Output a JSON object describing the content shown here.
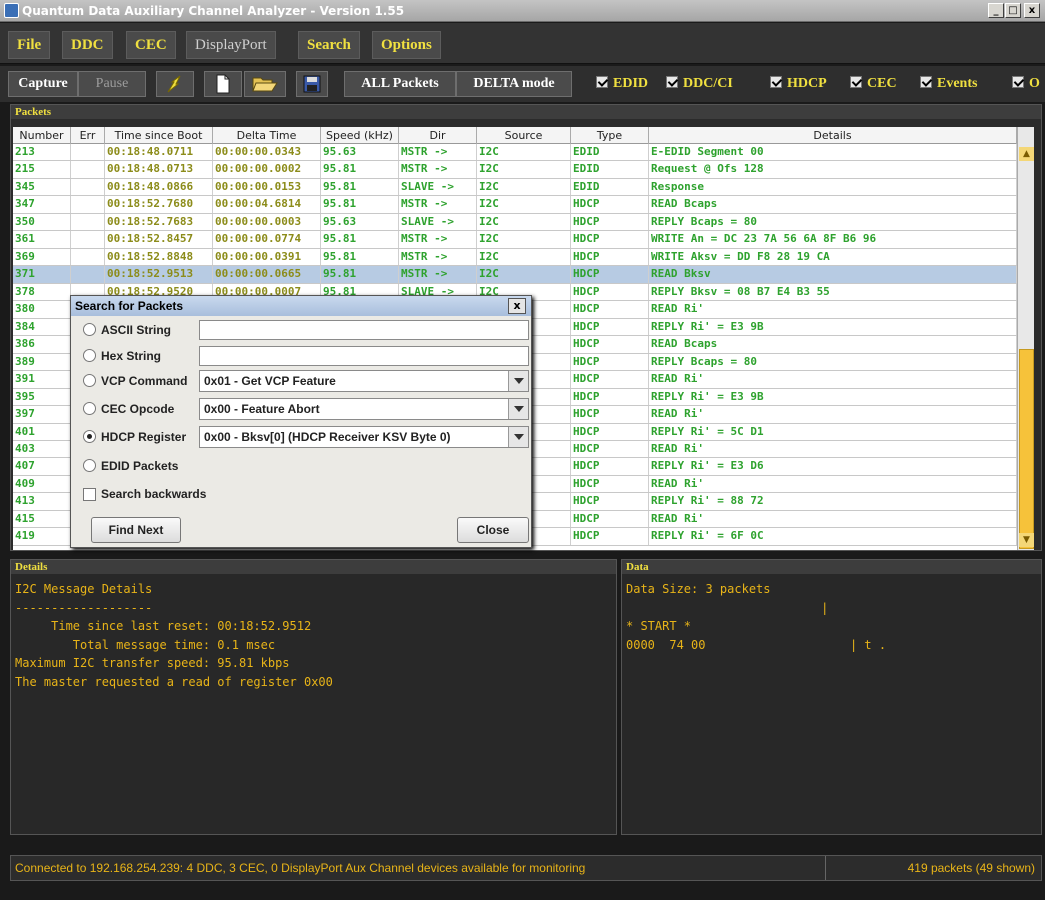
{
  "window": {
    "title": "Quantum Data Auxiliary Channel Analyzer - Version 1.55",
    "min": "_",
    "max": "□",
    "close": "x"
  },
  "menu": [
    {
      "label": "File",
      "enabled": true
    },
    {
      "label": "DDC",
      "enabled": true
    },
    {
      "label": "CEC",
      "enabled": true
    },
    {
      "label": "DisplayPort",
      "enabled": false
    },
    {
      "label": "Search",
      "enabled": true
    },
    {
      "label": "Options",
      "enabled": true
    }
  ],
  "toolbar": {
    "capture": "Capture",
    "pause": "Pause",
    "all_packets": "ALL Packets",
    "delta_mode": "DELTA mode",
    "filters": [
      "EDID",
      "DDC/CI",
      "HDCP",
      "CEC",
      "Events",
      "O"
    ]
  },
  "colors": {
    "accent": "#f0e040",
    "packet_text": "#2ea22e",
    "time_text": "#8c8c1a",
    "output_text": "#e8b418",
    "selected_row": "#b7cbe3"
  },
  "packets": {
    "header": "Packets",
    "columns": [
      "Number",
      "Err",
      "Time since Boot",
      "Delta Time",
      "Speed (kHz)",
      "Dir",
      "Source",
      "Type",
      "Details"
    ],
    "selected_number": "371",
    "rows": [
      [
        "213",
        "",
        "00:18:48.0711",
        "00:00:00.0343",
        "95.63",
        "MSTR ->",
        "I2C",
        "EDID",
        "E-EDID Segment 00"
      ],
      [
        "215",
        "",
        "00:18:48.0713",
        "00:00:00.0002",
        "95.81",
        "MSTR ->",
        "I2C",
        "EDID",
        "Request @ Ofs 128"
      ],
      [
        "345",
        "",
        "00:18:48.0866",
        "00:00:00.0153",
        "95.81",
        "SLAVE ->",
        "I2C",
        "EDID",
        "Response"
      ],
      [
        "347",
        "",
        "00:18:52.7680",
        "00:00:04.6814",
        "95.81",
        "MSTR ->",
        "I2C",
        "HDCP",
        "READ Bcaps"
      ],
      [
        "350",
        "",
        "00:18:52.7683",
        "00:00:00.0003",
        "95.63",
        "SLAVE ->",
        "I2C",
        "HDCP",
        "REPLY Bcaps = 80"
      ],
      [
        "361",
        "",
        "00:18:52.8457",
        "00:00:00.0774",
        "95.81",
        "MSTR ->",
        "I2C",
        "HDCP",
        "WRITE An = DC 23 7A 56 6A 8F B6 96"
      ],
      [
        "369",
        "",
        "00:18:52.8848",
        "00:00:00.0391",
        "95.81",
        "MSTR ->",
        "I2C",
        "HDCP",
        "WRITE Aksv = DD F8 28 19 CA"
      ],
      [
        "371",
        "",
        "00:18:52.9513",
        "00:00:00.0665",
        "95.81",
        "MSTR ->",
        "I2C",
        "HDCP",
        "READ Bksv"
      ],
      [
        "378",
        "",
        "00:18:52.9520",
        "00:00:00.0007",
        "95.81",
        "SLAVE ->",
        "I2C",
        "HDCP",
        "REPLY Bksv = 08 B7 E4 B3 55"
      ],
      [
        "380",
        "",
        "",
        "",
        "",
        "",
        "",
        "HDCP",
        "READ Ri'"
      ],
      [
        "384",
        "",
        "",
        "",
        "",
        "",
        "",
        "HDCP",
        "REPLY Ri' = E3 9B"
      ],
      [
        "386",
        "",
        "",
        "",
        "",
        "",
        "",
        "HDCP",
        "READ Bcaps"
      ],
      [
        "389",
        "",
        "",
        "",
        "",
        "",
        "",
        "HDCP",
        "REPLY Bcaps = 80"
      ],
      [
        "391",
        "",
        "",
        "",
        "",
        "",
        "",
        "HDCP",
        "READ Ri'"
      ],
      [
        "395",
        "",
        "",
        "",
        "",
        "",
        "",
        "HDCP",
        "REPLY Ri' = E3 9B"
      ],
      [
        "397",
        "",
        "",
        "",
        "",
        "",
        "",
        "HDCP",
        "READ Ri'"
      ],
      [
        "401",
        "",
        "",
        "",
        "",
        "",
        "",
        "HDCP",
        "REPLY Ri' = 5C D1"
      ],
      [
        "403",
        "",
        "",
        "",
        "",
        "",
        "",
        "HDCP",
        "READ Ri'"
      ],
      [
        "407",
        "",
        "",
        "",
        "",
        "",
        "",
        "HDCP",
        "REPLY Ri' = E3 D6"
      ],
      [
        "409",
        "",
        "",
        "",
        "",
        "",
        "",
        "HDCP",
        "READ Ri'"
      ],
      [
        "413",
        "",
        "",
        "",
        "",
        "",
        "",
        "HDCP",
        "REPLY Ri' = 88 72"
      ],
      [
        "415",
        "",
        "",
        "",
        "",
        "",
        "",
        "HDCP",
        "READ Ri'"
      ],
      [
        "419",
        "",
        "",
        "",
        "",
        "",
        "",
        "HDCP",
        "REPLY Ri' = 6F 0C"
      ]
    ]
  },
  "dialog": {
    "title": "Search for Packets",
    "close": "x",
    "options": [
      {
        "label": "ASCII String",
        "selected": false,
        "kind": "text",
        "value": ""
      },
      {
        "label": "Hex String",
        "selected": false,
        "kind": "text",
        "value": ""
      },
      {
        "label": "VCP Command",
        "selected": false,
        "kind": "combo",
        "value": "0x01 - Get VCP Feature"
      },
      {
        "label": "CEC Opcode",
        "selected": false,
        "kind": "combo",
        "value": "0x00 - Feature Abort"
      },
      {
        "label": "HDCP Register",
        "selected": true,
        "kind": "combo",
        "value": "0x00 - Bksv[0] (HDCP Receiver KSV Byte 0)"
      },
      {
        "label": "EDID Packets",
        "selected": false,
        "kind": "none",
        "value": ""
      }
    ],
    "search_backwards": "Search backwards",
    "find_next": "Find Next",
    "close_button": "Close"
  },
  "details": {
    "header": "Details",
    "lines": [
      "I2C Message Details",
      "-------------------",
      "     Time since last reset: 00:18:52.9512",
      "        Total message time: 0.1 msec",
      "Maximum I2C transfer speed: 95.81 kbps",
      "The master requested a read of register 0x00"
    ]
  },
  "data": {
    "header": "Data",
    "lines": [
      "Data Size: 3 packets",
      "                           |",
      "* START *",
      "0000  74 00                    | t ."
    ]
  },
  "status": {
    "left": "Connected to 192.168.254.239: 4 DDC, 3 CEC, 0 DisplayPort Aux Channel devices available for monitoring",
    "right": "419 packets (49 shown)"
  }
}
